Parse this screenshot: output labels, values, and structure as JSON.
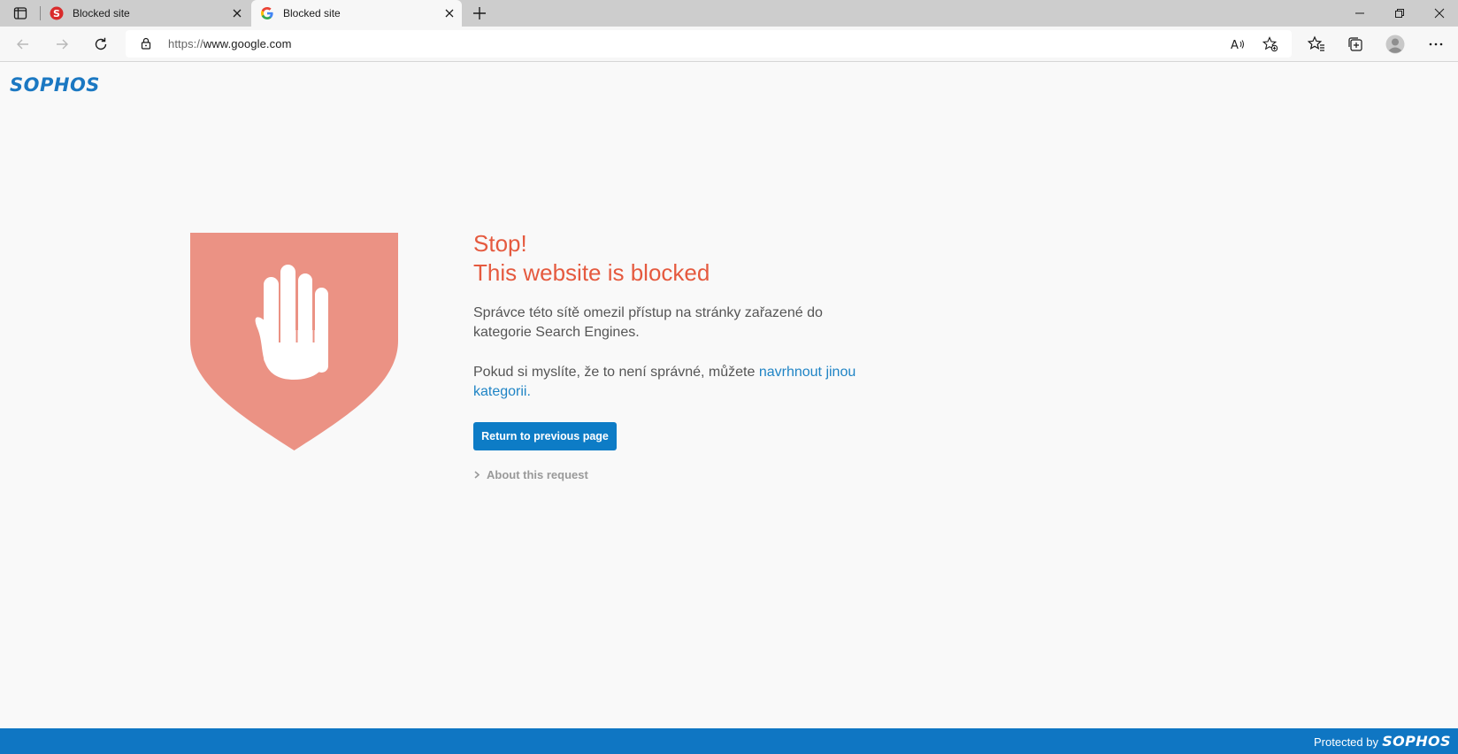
{
  "browser": {
    "tabs": [
      {
        "title": "Blocked site",
        "favicon": "sophos-favicon",
        "active": false
      },
      {
        "title": "Blocked site",
        "favicon": "google-favicon",
        "active": true
      }
    ],
    "address": {
      "scheme": "https://",
      "domain": "www.google.com"
    }
  },
  "page": {
    "logo": "SOPHOS",
    "heading_line1": "Stop!",
    "heading_line2": "This website is blocked",
    "message1": "Správce této sítě omezil přístup na stránky zařazené do kategorie Search Engines.",
    "message2_prefix": "Pokud si myslíte, že to není správné, můžete ",
    "message2_link": "navrhnout jinou kategorii.",
    "return_button": "Return to previous page",
    "about_request": "About this request"
  },
  "footer": {
    "protected_by": "Protected by",
    "logo": "SOPHOS"
  },
  "colors": {
    "accent": "#0d7cc6",
    "stop_red": "#e55a3f",
    "shield": "#eb9284"
  }
}
